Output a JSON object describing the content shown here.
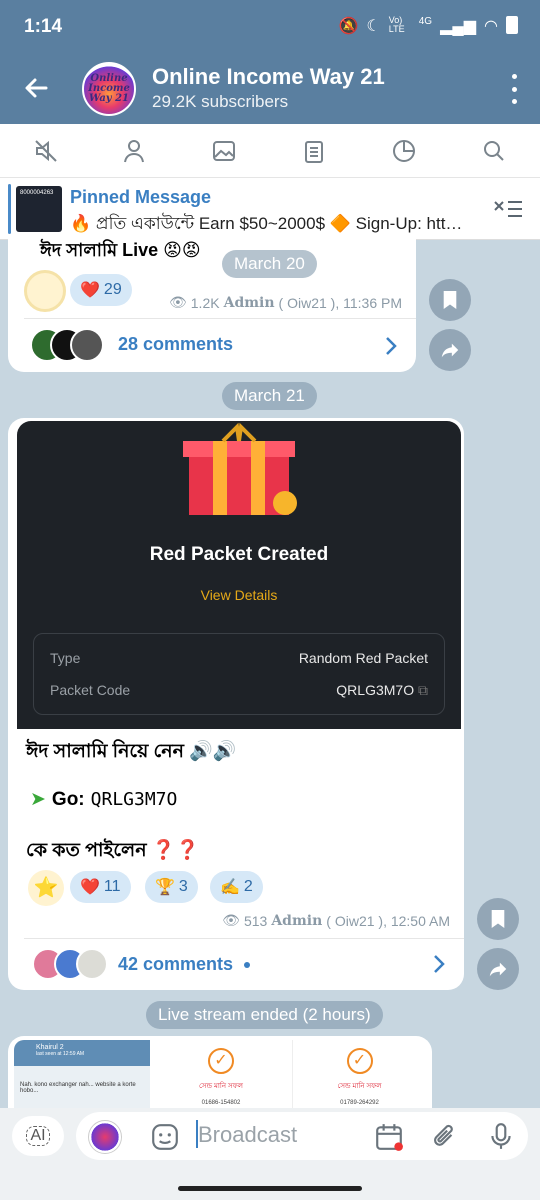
{
  "status": {
    "time": "1:14",
    "network": "4G",
    "carrier_badge": "Vo) LTE"
  },
  "header": {
    "title": "Online Income Way 21",
    "subtitle": "29.2K subscribers",
    "avatar_text": "Online Income Way 21"
  },
  "pinned": {
    "label": "Pinned Message",
    "text": "🔥 প্রতি একাউন্টে Earn $50~2000$ 🔶 Sign-Up: htt…",
    "thumb_text": "8000004263"
  },
  "post1": {
    "partial_text": "ঈদ সালামি Live 😡😡",
    "reaction": {
      "emoji": "❤️",
      "count": "29"
    },
    "views": "1.2K",
    "author": "Admin",
    "author_suffix": "( Oiw21 ), 11:36 PM",
    "comments": "28 comments"
  },
  "dates": {
    "d1": "March 20",
    "d2": "March 21"
  },
  "post2": {
    "card_title": "Red Packet Created",
    "card_link": "View Details",
    "type_label": "Type",
    "type_value": "Random Red Packet",
    "code_label": "Packet Code",
    "code_value": "QRLG3M7O",
    "line1": "ঈদ সালামি নিয়ে নেন 🔊🔊",
    "go_label": "Go:",
    "go_code": "QRLG3M7O",
    "line3": "কে কত পাইলেন ❓❓",
    "reactions": [
      {
        "emoji": "❤️",
        "count": "11"
      },
      {
        "emoji": "🏆",
        "count": "3"
      },
      {
        "emoji": "✍️",
        "count": "2"
      }
    ],
    "views": "513",
    "author": "Admin",
    "author_suffix": "( Oiw21 ), 12:50 AM",
    "comments": "42 comments"
  },
  "service": {
    "live_ended": "Live stream ended (2 hours)"
  },
  "post3_preview": {
    "chat_name": "Khairul 2",
    "chat_sub": "last seen at 12:59 AM",
    "chat_line": "Nah. kono exchanger nah... website a korte hobo...",
    "card1_title": "সেন্ড মানি সফল",
    "card1_num": "01686-154802",
    "card2_title": "সেন্ড মানি সফল",
    "card2_num": "01789-264292"
  },
  "input": {
    "placeholder": "Broadcast",
    "ai_label": "AI"
  },
  "colors": {
    "header": "#5a7fa0",
    "link": "#3a7fc2",
    "reaction_bg": "#d6e8f7",
    "chat_bg": "#c7d6e0"
  }
}
